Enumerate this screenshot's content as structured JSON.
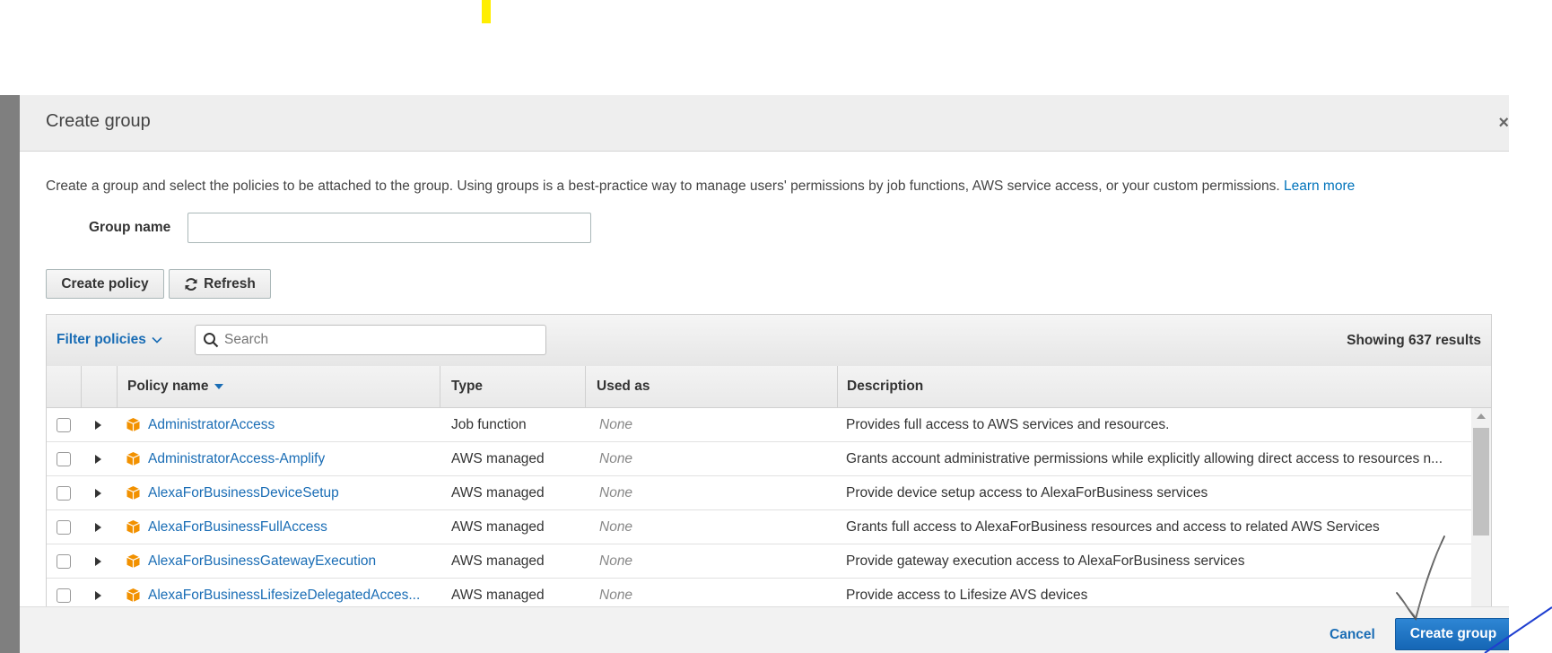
{
  "modal": {
    "title": "Create group",
    "close_glyph": "×",
    "intro_text": "Create a group and select the policies to be attached to the group. Using groups is a best-practice way to manage users' permissions by job functions, AWS service access, or your custom permissions.",
    "learn_more": "Learn more"
  },
  "group_name": {
    "label": "Group name",
    "value": ""
  },
  "toolbar": {
    "create_policy": "Create policy",
    "refresh": "Refresh"
  },
  "filter": {
    "label": "Filter policies",
    "search_placeholder": "Search",
    "showing": "Showing 637 results"
  },
  "table": {
    "columns": {
      "name": "Policy name",
      "type": "Type",
      "used_as": "Used as",
      "description": "Description"
    },
    "rows": [
      {
        "name": "AdministratorAccess",
        "type": "Job function",
        "used_as": "None",
        "description": "Provides full access to AWS services and resources."
      },
      {
        "name": "AdministratorAccess-Amplify",
        "type": "AWS managed",
        "used_as": "None",
        "description": "Grants account administrative permissions while explicitly allowing direct access to resources n..."
      },
      {
        "name": "AlexaForBusinessDeviceSetup",
        "type": "AWS managed",
        "used_as": "None",
        "description": "Provide device setup access to AlexaForBusiness services"
      },
      {
        "name": "AlexaForBusinessFullAccess",
        "type": "AWS managed",
        "used_as": "None",
        "description": "Grants full access to AlexaForBusiness resources and access to related AWS Services"
      },
      {
        "name": "AlexaForBusinessGatewayExecution",
        "type": "AWS managed",
        "used_as": "None",
        "description": "Provide gateway execution access to AlexaForBusiness services"
      },
      {
        "name": "AlexaForBusinessLifesizeDelegatedAcces...",
        "type": "AWS managed",
        "used_as": "None",
        "description": "Provide access to Lifesize AVS devices"
      }
    ]
  },
  "footer": {
    "cancel": "Cancel",
    "create_group": "Create group"
  },
  "colors": {
    "link": "#1a6db5",
    "primary": "#1566b5",
    "policy_icon": "#f29100",
    "marker": "#ffee00",
    "annotation": "#1f3fd0"
  },
  "icons": {
    "refresh": "refresh-icon",
    "search": "search-icon",
    "sort": "sort-desc-icon",
    "filter_chevron": "chevron-down-icon",
    "policy": "policy-cube-icon"
  }
}
